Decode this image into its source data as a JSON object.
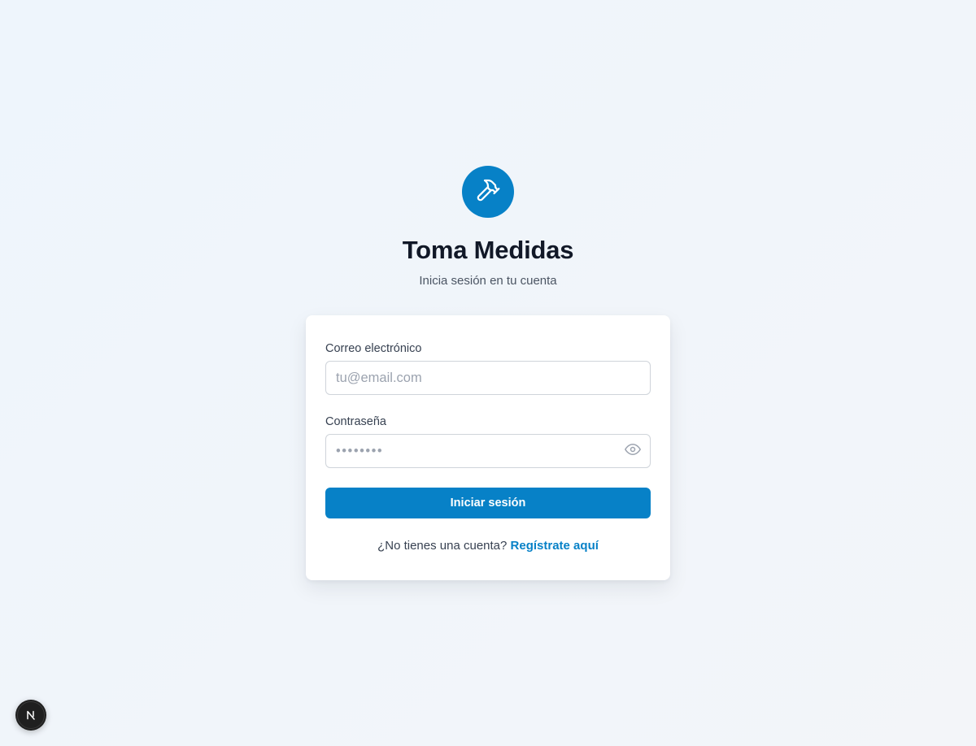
{
  "app": {
    "title": "Toma Medidas",
    "subtitle": "Inicia sesión en tu cuenta",
    "logo_icon": "hammer-icon",
    "accent_color": "#0781c7"
  },
  "form": {
    "email_label": "Correo electrónico",
    "email_placeholder": "tu@email.com",
    "email_value": "",
    "password_label": "Contraseña",
    "password_placeholder": "••••••••",
    "password_value": "",
    "password_toggle_icon": "eye-icon",
    "submit_label": "Iniciar sesión",
    "signup_prompt": "¿No tienes una cuenta?",
    "signup_link": "Regístrate aquí"
  },
  "dev_badge": {
    "icon": "nextjs-icon"
  }
}
